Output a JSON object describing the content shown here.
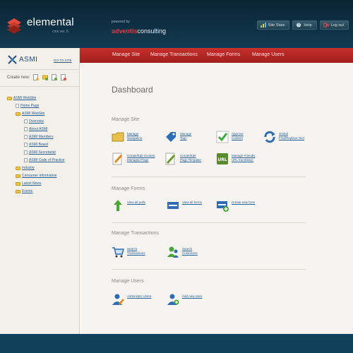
{
  "header": {
    "logo_text": "elemental",
    "logo_version": "cms ver. 5",
    "powered_by": "powered by",
    "powered_brand_a": "adventis",
    "powered_brand_b": "consulting",
    "buttons": [
      {
        "label": "Site Stats",
        "icon": "stats-icon"
      },
      {
        "label": "Help",
        "icon": "help-icon"
      },
      {
        "label": "Log out",
        "icon": "logout-icon"
      }
    ]
  },
  "sidebar": {
    "site_name": "ASMI",
    "goto_label": "GO TO SITE",
    "create_label": "Create new:",
    "tree": [
      {
        "label": "ASMI WebSite",
        "type": "folder",
        "level": 0
      },
      {
        "label": "Home Page",
        "type": "page",
        "level": 1
      },
      {
        "label": "ASMI WebSite",
        "type": "folder",
        "level": 1
      },
      {
        "label": "Overview",
        "type": "page",
        "level": 2
      },
      {
        "label": "About ASMI",
        "type": "page",
        "level": 2
      },
      {
        "label": "ASMI Members",
        "type": "page",
        "level": 2
      },
      {
        "label": "ASMI Board",
        "type": "page",
        "level": 2
      },
      {
        "label": "ASMI Secretariat",
        "type": "page",
        "level": 2
      },
      {
        "label": "ASMI Code of Practice",
        "type": "page",
        "level": 2
      },
      {
        "label": "Industry",
        "type": "folder",
        "level": 1
      },
      {
        "label": "Consumer Information",
        "type": "folder",
        "level": 1
      },
      {
        "label": "Latest News",
        "type": "folder",
        "level": 1
      },
      {
        "label": "Events",
        "type": "folder",
        "level": 1
      }
    ]
  },
  "nav": {
    "items": [
      "Manage Site",
      "Manage Transactions",
      "Manage Forms",
      "Manage Users"
    ]
  },
  "main": {
    "title": "Dashboard",
    "sections": {
      "site": {
        "heading": "Manage Site",
        "actions": [
          {
            "line1": "Manage",
            "line2": "Navigation",
            "icon": "folder-icon"
          },
          {
            "line1": "Manage",
            "line2": "Tags",
            "icon": "tag-icon"
          },
          {
            "line1": "Approve",
            "line2": "Content",
            "icon": "checkmark-icon"
          },
          {
            "line1": "Global",
            "line2": "Find/Replace Text",
            "icon": "refresh-icon"
          },
          {
            "line1": "Create/Edit Content",
            "line2": "Managed Page",
            "icon": "edit-page-icon"
          },
          {
            "line1": "Create/Edit",
            "line2": "Page Template",
            "icon": "edit-template-icon"
          },
          {
            "line1": "Manage Friendly",
            "line2": "URL translation",
            "icon": "url-icon"
          }
        ]
      },
      "forms": {
        "heading": "Manage Forms",
        "actions": [
          {
            "line1": "View all polls",
            "line2": "",
            "icon": "polls-icon"
          },
          {
            "line1": "View all forms",
            "line2": "",
            "icon": "form-icon"
          },
          {
            "line1": "Create new form",
            "line2": "",
            "icon": "new-form-icon"
          }
        ]
      },
      "transactions": {
        "heading": "Manage Transactions",
        "actions": [
          {
            "line1": "Search",
            "line2": "Transactions",
            "icon": "cart-icon"
          },
          {
            "line1": "Search",
            "line2": "Customers",
            "icon": "customers-icon"
          }
        ]
      },
      "users": {
        "heading": "Manage Users",
        "actions": [
          {
            "line1": "Administer Users",
            "line2": "",
            "icon": "administer-users-icon"
          },
          {
            "line1": "Add new User",
            "line2": "",
            "icon": "add-user-icon"
          }
        ]
      }
    }
  }
}
